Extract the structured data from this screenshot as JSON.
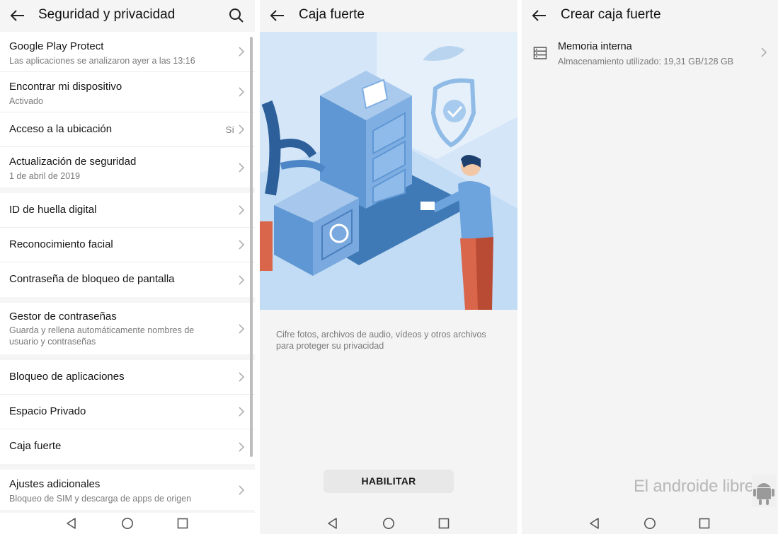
{
  "panel1": {
    "title": "Seguridad y privacidad",
    "groups": [
      [
        {
          "title": "Google Play Protect",
          "subtitle": "Las aplicaciones se analizaron ayer a las 13:16"
        },
        {
          "title": "Encontrar mi dispositivo",
          "subtitle": "Activado"
        },
        {
          "title": "Acceso a la ubicación",
          "value": "Sí"
        },
        {
          "title": "Actualización de seguridad",
          "subtitle": "1 de abril de 2019"
        }
      ],
      [
        {
          "title": "ID de huella digital"
        },
        {
          "title": "Reconocimiento facial"
        },
        {
          "title": "Contraseña de bloqueo de pantalla"
        }
      ],
      [
        {
          "title": "Gestor de contraseñas",
          "subtitle": "Guarda y rellena automáticamente nombres de usuario y contraseñas"
        }
      ],
      [
        {
          "title": "Bloqueo de aplicaciones"
        },
        {
          "title": "Espacio Privado"
        },
        {
          "title": "Caja fuerte"
        }
      ],
      [
        {
          "title": "Ajustes adicionales",
          "subtitle": "Bloqueo de SIM y descarga de apps de origen"
        }
      ]
    ]
  },
  "panel2": {
    "title": "Caja fuerte",
    "description": "Cifre fotos, archivos de audio, vídeos y otros archivos para proteger su privacidad",
    "button": "HABILITAR"
  },
  "panel3": {
    "title": "Crear caja fuerte",
    "storage": {
      "title": "Memoria interna",
      "subtitle": "Almacenamiento utilizado: 19,31 GB/128 GB"
    },
    "watermark": "El androide libre"
  },
  "icons": {
    "back": "back-arrow-icon",
    "search": "search-icon",
    "chevron": "chevron-right-icon",
    "storage": "storage-icon",
    "nav_back": "nav-back-icon",
    "nav_home": "nav-home-icon",
    "nav_recents": "nav-recents-icon"
  },
  "colors": {
    "illustration_bg": "#cfe3f7",
    "accent_blue": "#6a9fd8",
    "button_bg": "#e8e8e8"
  }
}
